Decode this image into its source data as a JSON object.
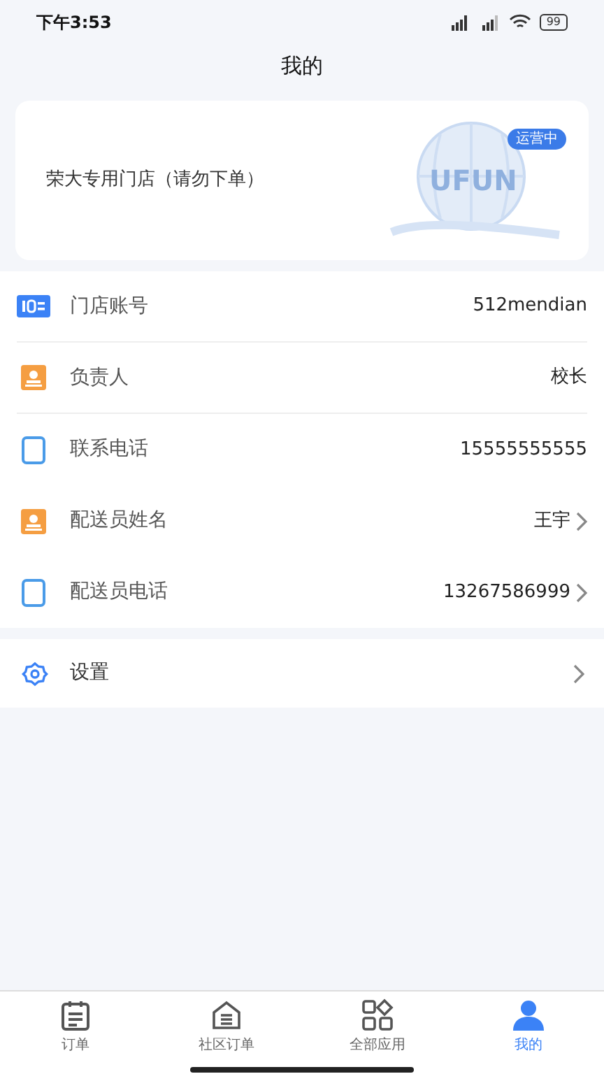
{
  "status_bar": {
    "time": "下午3:53",
    "battery": "99"
  },
  "title": "我的",
  "store": {
    "name": "荣大专用门店（请勿下单）",
    "logo_text": "UFUN",
    "badge": "运营中"
  },
  "info_rows": [
    {
      "kind": "id",
      "label": "门店账号",
      "value": "512mendian",
      "chevron": false,
      "divider": true
    },
    {
      "kind": "person",
      "label": "负责人",
      "value": "校长",
      "chevron": false,
      "divider": true
    },
    {
      "kind": "phone",
      "label": "联系电话",
      "value": "15555555555",
      "chevron": false,
      "divider": false
    },
    {
      "kind": "person",
      "label": "配送员姓名",
      "value": "王宇",
      "chevron": true,
      "divider": false
    },
    {
      "kind": "phone",
      "label": "配送员电话",
      "value": "13267586999",
      "chevron": true,
      "divider": false
    }
  ],
  "settings": {
    "label": "设置",
    "chevron": true
  },
  "tabs": [
    {
      "kind": "orders",
      "label": "订单",
      "selected": false
    },
    {
      "kind": "community",
      "label": "社区订单",
      "selected": false
    },
    {
      "kind": "apps",
      "label": "全部应用",
      "selected": false
    },
    {
      "kind": "me",
      "label": "我的",
      "selected": true
    }
  ]
}
